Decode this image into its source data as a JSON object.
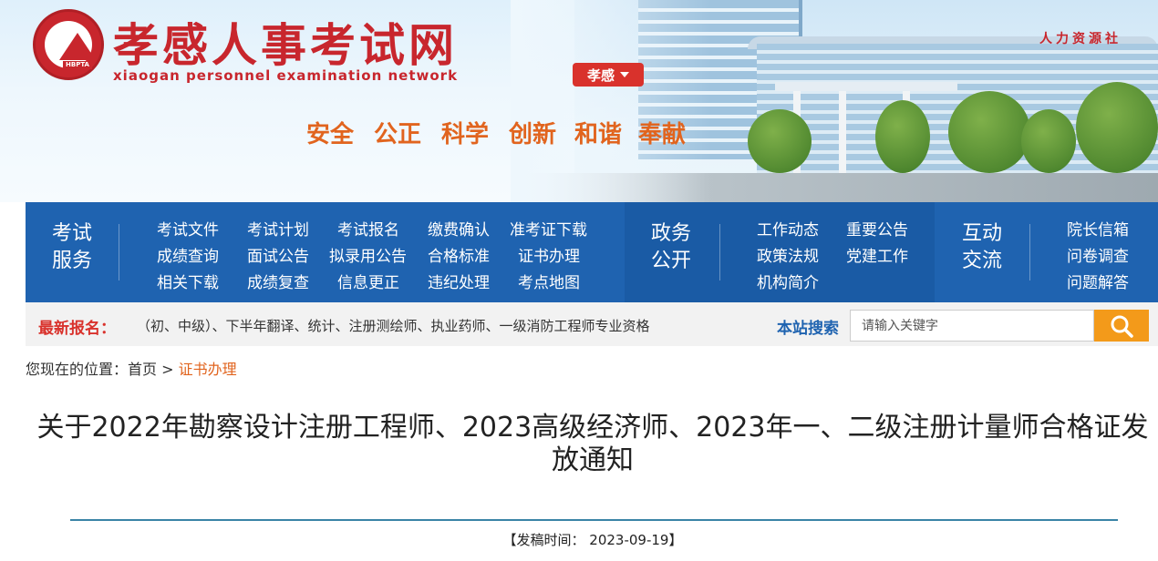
{
  "header": {
    "site_title": "孝感人事考试网",
    "site_subtitle": "xiaogan personnel examination network",
    "logo_text": "HBPTA",
    "city_selector": "孝感",
    "slogans": [
      "安全",
      "公正",
      "科学",
      "创新",
      "和谐",
      "奉献"
    ],
    "building_sign": "人力资源社"
  },
  "nav": {
    "sections": [
      {
        "title_line1": "考试",
        "title_line2": "服务",
        "links": [
          "考试文件",
          "考试计划",
          "考试报名",
          "缴费确认",
          "准考证下载",
          "成绩查询",
          "面试公告",
          "拟录用公告",
          "合格标准",
          "证书办理",
          "相关下载",
          "成绩复查",
          "信息更正",
          "违纪处理",
          "考点地图"
        ]
      },
      {
        "title_line1": "政务",
        "title_line2": "公开",
        "links": [
          "工作动态",
          "重要公告",
          "政策法规",
          "党建工作",
          "机构简介"
        ]
      },
      {
        "title_line1": "互动",
        "title_line2": "交流",
        "links": [
          "院长信箱",
          "问卷调查",
          "问题解答"
        ]
      }
    ]
  },
  "ticker": {
    "label": "最新报名：",
    "text": "（初、中级）、下半年翻译、统计、注册测绘师、执业药师、一级消防工程师专业资格"
  },
  "search": {
    "label": "本站搜索",
    "placeholder": "请输入关键字"
  },
  "breadcrumb": {
    "prefix": "您现在的位置：",
    "home": "首页",
    "separator": ">",
    "current": "证书办理"
  },
  "article": {
    "title": "关于2022年勘察设计注册工程师、2023高级经济师、2023年一、二级注册计量师合格证发放通知",
    "meta": "【发稿时间： 2023-09-19】"
  },
  "colors": {
    "brand_red": "#c8262d",
    "nav_blue": "#1f63b0",
    "accent_orange": "#e1641e",
    "search_orange": "#f39a1a"
  }
}
